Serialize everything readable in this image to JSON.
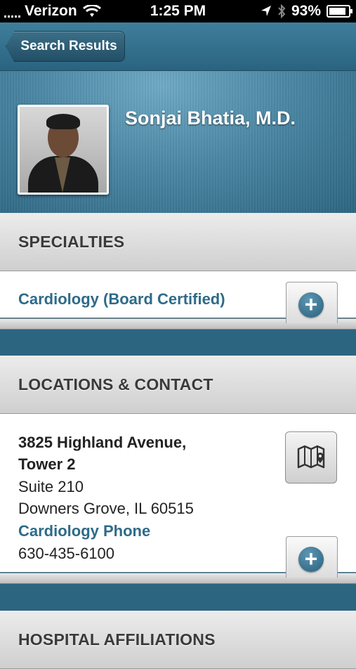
{
  "status_bar": {
    "carrier": "Verizon",
    "time": "1:25 PM",
    "battery": "93%"
  },
  "nav": {
    "back_label": "Search Results"
  },
  "profile": {
    "name": "Sonjai Bhatia, M.D."
  },
  "specialties": {
    "heading": "SPECIALTIES",
    "items": [
      "Cardiology (Board Certified)"
    ]
  },
  "locations": {
    "heading": "LOCATIONS & CONTACT",
    "address_line1": "3825 Highland Avenue,",
    "address_line2": "Tower 2",
    "suite": "Suite 210",
    "city_state_zip": "Downers Grove, IL 60515",
    "phone_label": "Cardiology Phone",
    "phone": "630-435-6100"
  },
  "next_section": {
    "heading": "HOSPITAL AFFILIATIONS"
  },
  "colors": {
    "accent": "#2e6b88",
    "header_blue": "#4b87a4"
  }
}
